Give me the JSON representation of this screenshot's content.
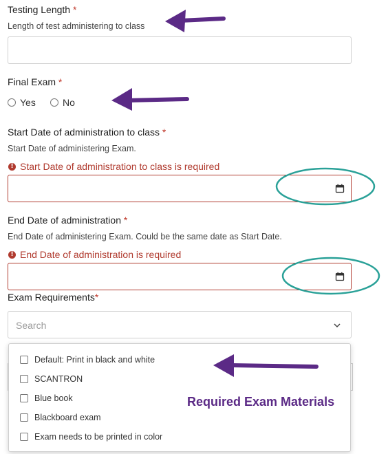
{
  "testing_length": {
    "label": "Testing Length",
    "required_mark": "*",
    "help": "Length of test administering to class",
    "value": ""
  },
  "final_exam": {
    "label": "Final Exam",
    "required_mark": "*",
    "options": [
      "Yes",
      "No"
    ]
  },
  "start_date": {
    "label": "Start Date of administration to class",
    "required_mark": "*",
    "help": "Start Date of administering Exam.",
    "error": "Start Date of administration to class is required",
    "value": ""
  },
  "end_date": {
    "label": "End Date of administration",
    "required_mark": "*",
    "help": "End Date of administering Exam. Could be the same date as Start Date.",
    "error": "End Date of administration is required",
    "value": ""
  },
  "exam_requirements": {
    "label": "Exam Requirements",
    "required_mark": "*",
    "placeholder": "Search",
    "options": [
      "Default: Print in black and white",
      "SCANTRON",
      "Blue book",
      "Blackboard exam",
      "Exam needs to be printed in color"
    ]
  },
  "annotation": {
    "text": "Required Exam Materials"
  },
  "colors": {
    "arrow": "#5b2a86",
    "circle": "#2aa198",
    "error": "#b03a2e"
  }
}
